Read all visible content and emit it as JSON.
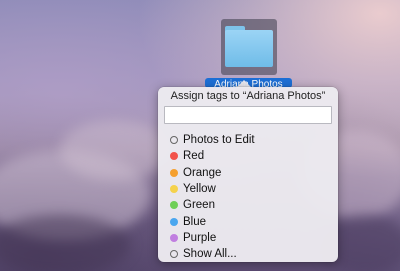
{
  "folder": {
    "name": "Adriana Photos",
    "icon": "folder-icon"
  },
  "popover": {
    "title": "Assign tags to “Adriana Photos”",
    "input": {
      "value": "",
      "placeholder": ""
    },
    "tags": [
      {
        "label": "Photos to Edit",
        "color": "",
        "hollow": true
      },
      {
        "label": "Red",
        "color": "#f2524a",
        "hollow": false
      },
      {
        "label": "Orange",
        "color": "#f5a02f",
        "hollow": false
      },
      {
        "label": "Yellow",
        "color": "#f5d24c",
        "hollow": false
      },
      {
        "label": "Green",
        "color": "#6fcf57",
        "hollow": false
      },
      {
        "label": "Blue",
        "color": "#4aa6ef",
        "hollow": false
      },
      {
        "label": "Purple",
        "color": "#c07ee0",
        "hollow": false
      },
      {
        "label": "Show All...",
        "color": "",
        "hollow": true
      }
    ]
  }
}
